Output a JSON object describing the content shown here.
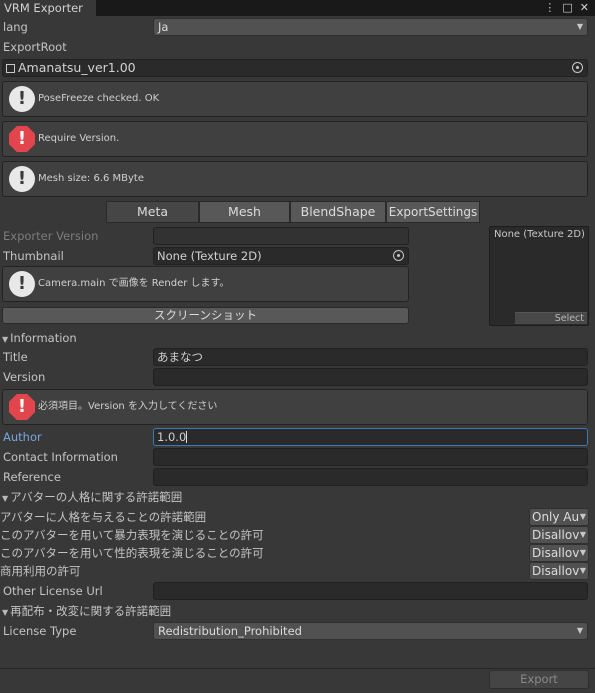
{
  "window": {
    "tab_title": "VRM Exporter",
    "menu_icon": "⋮",
    "maximize_icon": "□",
    "close_icon": "✕"
  },
  "lang": {
    "label": "lang",
    "value": "Ja"
  },
  "export_root": {
    "label": "ExportRoot",
    "value": "Amanatsu_ver1.00"
  },
  "messages": [
    {
      "type": "info",
      "text": "PoseFreeze checked. OK"
    },
    {
      "type": "error",
      "text": "Require Version."
    },
    {
      "type": "info",
      "text": "Mesh size: 6.6 MByte"
    }
  ],
  "tabs": [
    "Meta",
    "Mesh",
    "BlendShape",
    "ExportSettings"
  ],
  "meta": {
    "exporter_version_label": "Exporter Version",
    "exporter_version_value": "",
    "thumbnail_label": "Thumbnail",
    "thumbnail_value": "None (Texture 2D)",
    "preview_label": "None (Texture 2D)",
    "preview_select": "Select",
    "camera_help": "Camera.main で画像を Render します。",
    "screenshot_button": "スクリーンショット"
  },
  "information": {
    "header": "Information",
    "title_label": "Title",
    "title_value": "あまなつ",
    "version_label": "Version",
    "version_value": "",
    "version_error": "必須項目。Version を入力してください",
    "author_label": "Author",
    "author_value": "1.0.0",
    "contact_label": "Contact Information",
    "contact_value": "",
    "reference_label": "Reference",
    "reference_value": ""
  },
  "persona": {
    "header": "アバターの人格に関する許諾範囲",
    "rows": [
      {
        "label": "アバターに人格を与えることの許諾範囲",
        "value": "Only Au"
      },
      {
        "label": "このアバターを用いて暴力表現を演じることの許可",
        "value": "Disallov"
      },
      {
        "label": "このアバターを用いて性的表現を演じることの許可",
        "value": "Disallov"
      },
      {
        "label": "商用利用の許可",
        "value": "Disallov"
      }
    ],
    "other_license_label": "Other License Url",
    "other_license_value": ""
  },
  "redistribution": {
    "header": "再配布・改変に関する許諾範囲",
    "license_type_label": "License Type",
    "license_type_value": "Redistribution_Prohibited"
  },
  "export_button": "Export",
  "colors": {
    "background": "#383838",
    "field": "#2a2a2a",
    "focus": "#3a79bb",
    "error": "#e2454b",
    "author_label": "#7aa6dd"
  }
}
